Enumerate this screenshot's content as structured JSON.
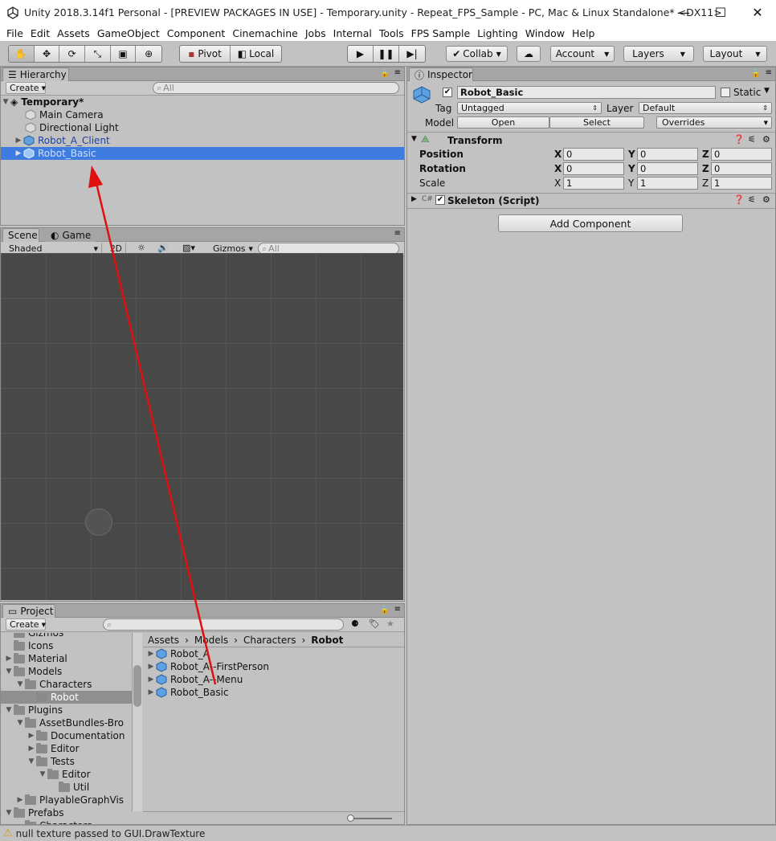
{
  "window": {
    "title": "Unity 2018.3.14f1 Personal - [PREVIEW PACKAGES IN USE] - Temporary.unity - Repeat_FPS_Sample - PC, Mac & Linux Standalone* <DX11>",
    "minimize": "—",
    "maximize": "☐",
    "close": "✕"
  },
  "menu": [
    "File",
    "Edit",
    "Assets",
    "GameObject",
    "Component",
    "Cinemachine",
    "Jobs",
    "Internal",
    "Tools",
    "FPS Sample",
    "Lighting",
    "Window",
    "Help"
  ],
  "toolbar": {
    "pivot": "Pivot",
    "local": "Local",
    "collab": "Collab",
    "account": "Account",
    "layers": "Layers",
    "layout": "Layout"
  },
  "hierarchy": {
    "tab": "Hierarchy",
    "create": "Create",
    "search_placeholder": "All",
    "scene": "Temporary*",
    "items": [
      {
        "label": "Main Camera"
      },
      {
        "label": "Directional Light"
      },
      {
        "label": "Robot_A_Client"
      },
      {
        "label": "Robot_Basic"
      }
    ]
  },
  "scene": {
    "tab_scene": "Scene",
    "tab_game": "Game",
    "shading": "Shaded",
    "mode_2d": "2D",
    "gizmos": "Gizmos",
    "search_placeholder": "All"
  },
  "inspector": {
    "tab": "Inspector",
    "name": "Robot_Basic",
    "static": "Static",
    "tag_label": "Tag",
    "tag": "Untagged",
    "layer_label": "Layer",
    "layer": "Default",
    "model_label": "Model",
    "open": "Open",
    "select": "Select",
    "overrides": "Overrides",
    "transform": "Transform",
    "position": "Position",
    "rotation": "Rotation",
    "scale": "Scale",
    "axis_x": "X",
    "axis_y": "Y",
    "axis_z": "Z",
    "pos": [
      "0",
      "0",
      "0"
    ],
    "rot": [
      "0",
      "0",
      "0"
    ],
    "scl": [
      "1",
      "1",
      "1"
    ],
    "skeleton": "Skeleton (Script)",
    "add_component": "Add Component"
  },
  "project": {
    "tab": "Project",
    "create": "Create",
    "tree": [
      {
        "label": "Gizmos",
        "indent": 2
      },
      {
        "label": "Icons",
        "indent": 2
      },
      {
        "label": "Material",
        "indent": 2
      },
      {
        "label": "Models",
        "indent": 2
      },
      {
        "label": "Characters",
        "indent": 3
      },
      {
        "label": "Robot",
        "indent": 4
      },
      {
        "label": "Plugins",
        "indent": 2
      },
      {
        "label": "AssetBundles-Bro",
        "indent": 3
      },
      {
        "label": "Documentation",
        "indent": 4
      },
      {
        "label": "Editor",
        "indent": 4
      },
      {
        "label": "Tests",
        "indent": 4
      },
      {
        "label": "Editor",
        "indent": 5
      },
      {
        "label": "Util",
        "indent": 6
      },
      {
        "label": "PlayableGraphVis",
        "indent": 3
      },
      {
        "label": "Prefabs",
        "indent": 2
      },
      {
        "label": "Characters",
        "indent": 3
      }
    ],
    "breadcrumb": [
      "Assets",
      "Models",
      "Characters",
      "Robot"
    ],
    "assets": [
      "Robot_A",
      "Robot_A--FirstPerson",
      "Robot_A--Menu",
      "Robot_Basic"
    ]
  },
  "status": {
    "message": "null texture passed to GUI.DrawTexture"
  },
  "colors": {
    "selection": "#3e7ce0",
    "prefab_text": "#1f3fa0",
    "annotation_arrow": "#e01010"
  }
}
